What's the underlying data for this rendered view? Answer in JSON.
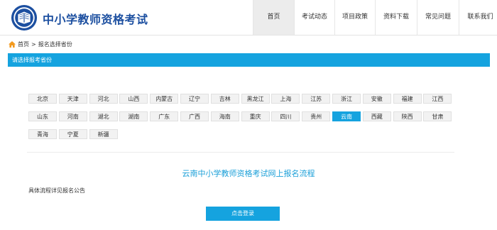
{
  "header": {
    "site_title": "中小学教师资格考试",
    "nav": [
      "首页",
      "考试动态",
      "项目政策",
      "资料下载",
      "常见问题",
      "联系我们"
    ],
    "active_nav": "首页"
  },
  "breadcrumb": {
    "home": "首页",
    "separator": ">",
    "current": "报名选择省份"
  },
  "section_title": "请选择报考省份",
  "provinces": [
    "北京",
    "天津",
    "河北",
    "山西",
    "内蒙古",
    "辽宁",
    "吉林",
    "黑龙江",
    "上海",
    "江苏",
    "浙江",
    "安徽",
    "福建",
    "江西",
    "山东",
    "河南",
    "湖北",
    "湖南",
    "广东",
    "广西",
    "海南",
    "重庆",
    "四川",
    "贵州",
    "云南",
    "西藏",
    "陕西",
    "甘肃",
    "青海",
    "宁夏",
    "新疆"
  ],
  "selected_province": "云南",
  "process_title": "云南中小学教师资格考试网上报名流程",
  "note": "具体流程详见报名公告",
  "login_button": "点击登录",
  "colors": {
    "accent": "#15a3df",
    "brand": "#1c4fa0"
  }
}
